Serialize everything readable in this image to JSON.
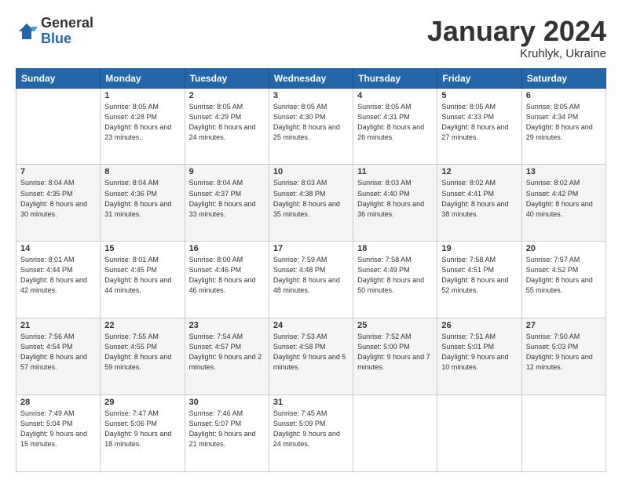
{
  "logo": {
    "general": "General",
    "blue": "Blue"
  },
  "header": {
    "title": "January 2024",
    "location": "Kruhlyk, Ukraine"
  },
  "weekdays": [
    "Sunday",
    "Monday",
    "Tuesday",
    "Wednesday",
    "Thursday",
    "Friday",
    "Saturday"
  ],
  "weeks": [
    [
      {
        "day": "",
        "sunrise": "",
        "sunset": "",
        "daylight": ""
      },
      {
        "day": "1",
        "sunrise": "Sunrise: 8:05 AM",
        "sunset": "Sunset: 4:28 PM",
        "daylight": "Daylight: 8 hours and 23 minutes."
      },
      {
        "day": "2",
        "sunrise": "Sunrise: 8:05 AM",
        "sunset": "Sunset: 4:29 PM",
        "daylight": "Daylight: 8 hours and 24 minutes."
      },
      {
        "day": "3",
        "sunrise": "Sunrise: 8:05 AM",
        "sunset": "Sunset: 4:30 PM",
        "daylight": "Daylight: 8 hours and 25 minutes."
      },
      {
        "day": "4",
        "sunrise": "Sunrise: 8:05 AM",
        "sunset": "Sunset: 4:31 PM",
        "daylight": "Daylight: 8 hours and 26 minutes."
      },
      {
        "day": "5",
        "sunrise": "Sunrise: 8:05 AM",
        "sunset": "Sunset: 4:33 PM",
        "daylight": "Daylight: 8 hours and 27 minutes."
      },
      {
        "day": "6",
        "sunrise": "Sunrise: 8:05 AM",
        "sunset": "Sunset: 4:34 PM",
        "daylight": "Daylight: 8 hours and 29 minutes."
      }
    ],
    [
      {
        "day": "7",
        "sunrise": "Sunrise: 8:04 AM",
        "sunset": "Sunset: 4:35 PM",
        "daylight": "Daylight: 8 hours and 30 minutes."
      },
      {
        "day": "8",
        "sunrise": "Sunrise: 8:04 AM",
        "sunset": "Sunset: 4:36 PM",
        "daylight": "Daylight: 8 hours and 31 minutes."
      },
      {
        "day": "9",
        "sunrise": "Sunrise: 8:04 AM",
        "sunset": "Sunset: 4:37 PM",
        "daylight": "Daylight: 8 hours and 33 minutes."
      },
      {
        "day": "10",
        "sunrise": "Sunrise: 8:03 AM",
        "sunset": "Sunset: 4:38 PM",
        "daylight": "Daylight: 8 hours and 35 minutes."
      },
      {
        "day": "11",
        "sunrise": "Sunrise: 8:03 AM",
        "sunset": "Sunset: 4:40 PM",
        "daylight": "Daylight: 8 hours and 36 minutes."
      },
      {
        "day": "12",
        "sunrise": "Sunrise: 8:02 AM",
        "sunset": "Sunset: 4:41 PM",
        "daylight": "Daylight: 8 hours and 38 minutes."
      },
      {
        "day": "13",
        "sunrise": "Sunrise: 8:02 AM",
        "sunset": "Sunset: 4:42 PM",
        "daylight": "Daylight: 8 hours and 40 minutes."
      }
    ],
    [
      {
        "day": "14",
        "sunrise": "Sunrise: 8:01 AM",
        "sunset": "Sunset: 4:44 PM",
        "daylight": "Daylight: 8 hours and 42 minutes."
      },
      {
        "day": "15",
        "sunrise": "Sunrise: 8:01 AM",
        "sunset": "Sunset: 4:45 PM",
        "daylight": "Daylight: 8 hours and 44 minutes."
      },
      {
        "day": "16",
        "sunrise": "Sunrise: 8:00 AM",
        "sunset": "Sunset: 4:46 PM",
        "daylight": "Daylight: 8 hours and 46 minutes."
      },
      {
        "day": "17",
        "sunrise": "Sunrise: 7:59 AM",
        "sunset": "Sunset: 4:48 PM",
        "daylight": "Daylight: 8 hours and 48 minutes."
      },
      {
        "day": "18",
        "sunrise": "Sunrise: 7:58 AM",
        "sunset": "Sunset: 4:49 PM",
        "daylight": "Daylight: 8 hours and 50 minutes."
      },
      {
        "day": "19",
        "sunrise": "Sunrise: 7:58 AM",
        "sunset": "Sunset: 4:51 PM",
        "daylight": "Daylight: 8 hours and 52 minutes."
      },
      {
        "day": "20",
        "sunrise": "Sunrise: 7:57 AM",
        "sunset": "Sunset: 4:52 PM",
        "daylight": "Daylight: 8 hours and 55 minutes."
      }
    ],
    [
      {
        "day": "21",
        "sunrise": "Sunrise: 7:56 AM",
        "sunset": "Sunset: 4:54 PM",
        "daylight": "Daylight: 8 hours and 57 minutes."
      },
      {
        "day": "22",
        "sunrise": "Sunrise: 7:55 AM",
        "sunset": "Sunset: 4:55 PM",
        "daylight": "Daylight: 8 hours and 59 minutes."
      },
      {
        "day": "23",
        "sunrise": "Sunrise: 7:54 AM",
        "sunset": "Sunset: 4:57 PM",
        "daylight": "Daylight: 9 hours and 2 minutes."
      },
      {
        "day": "24",
        "sunrise": "Sunrise: 7:53 AM",
        "sunset": "Sunset: 4:58 PM",
        "daylight": "Daylight: 9 hours and 5 minutes."
      },
      {
        "day": "25",
        "sunrise": "Sunrise: 7:52 AM",
        "sunset": "Sunset: 5:00 PM",
        "daylight": "Daylight: 9 hours and 7 minutes."
      },
      {
        "day": "26",
        "sunrise": "Sunrise: 7:51 AM",
        "sunset": "Sunset: 5:01 PM",
        "daylight": "Daylight: 9 hours and 10 minutes."
      },
      {
        "day": "27",
        "sunrise": "Sunrise: 7:50 AM",
        "sunset": "Sunset: 5:03 PM",
        "daylight": "Daylight: 9 hours and 12 minutes."
      }
    ],
    [
      {
        "day": "28",
        "sunrise": "Sunrise: 7:49 AM",
        "sunset": "Sunset: 5:04 PM",
        "daylight": "Daylight: 9 hours and 15 minutes."
      },
      {
        "day": "29",
        "sunrise": "Sunrise: 7:47 AM",
        "sunset": "Sunset: 5:06 PM",
        "daylight": "Daylight: 9 hours and 18 minutes."
      },
      {
        "day": "30",
        "sunrise": "Sunrise: 7:46 AM",
        "sunset": "Sunset: 5:07 PM",
        "daylight": "Daylight: 9 hours and 21 minutes."
      },
      {
        "day": "31",
        "sunrise": "Sunrise: 7:45 AM",
        "sunset": "Sunset: 5:09 PM",
        "daylight": "Daylight: 9 hours and 24 minutes."
      },
      {
        "day": "",
        "sunrise": "",
        "sunset": "",
        "daylight": ""
      },
      {
        "day": "",
        "sunrise": "",
        "sunset": "",
        "daylight": ""
      },
      {
        "day": "",
        "sunrise": "",
        "sunset": "",
        "daylight": ""
      }
    ]
  ]
}
